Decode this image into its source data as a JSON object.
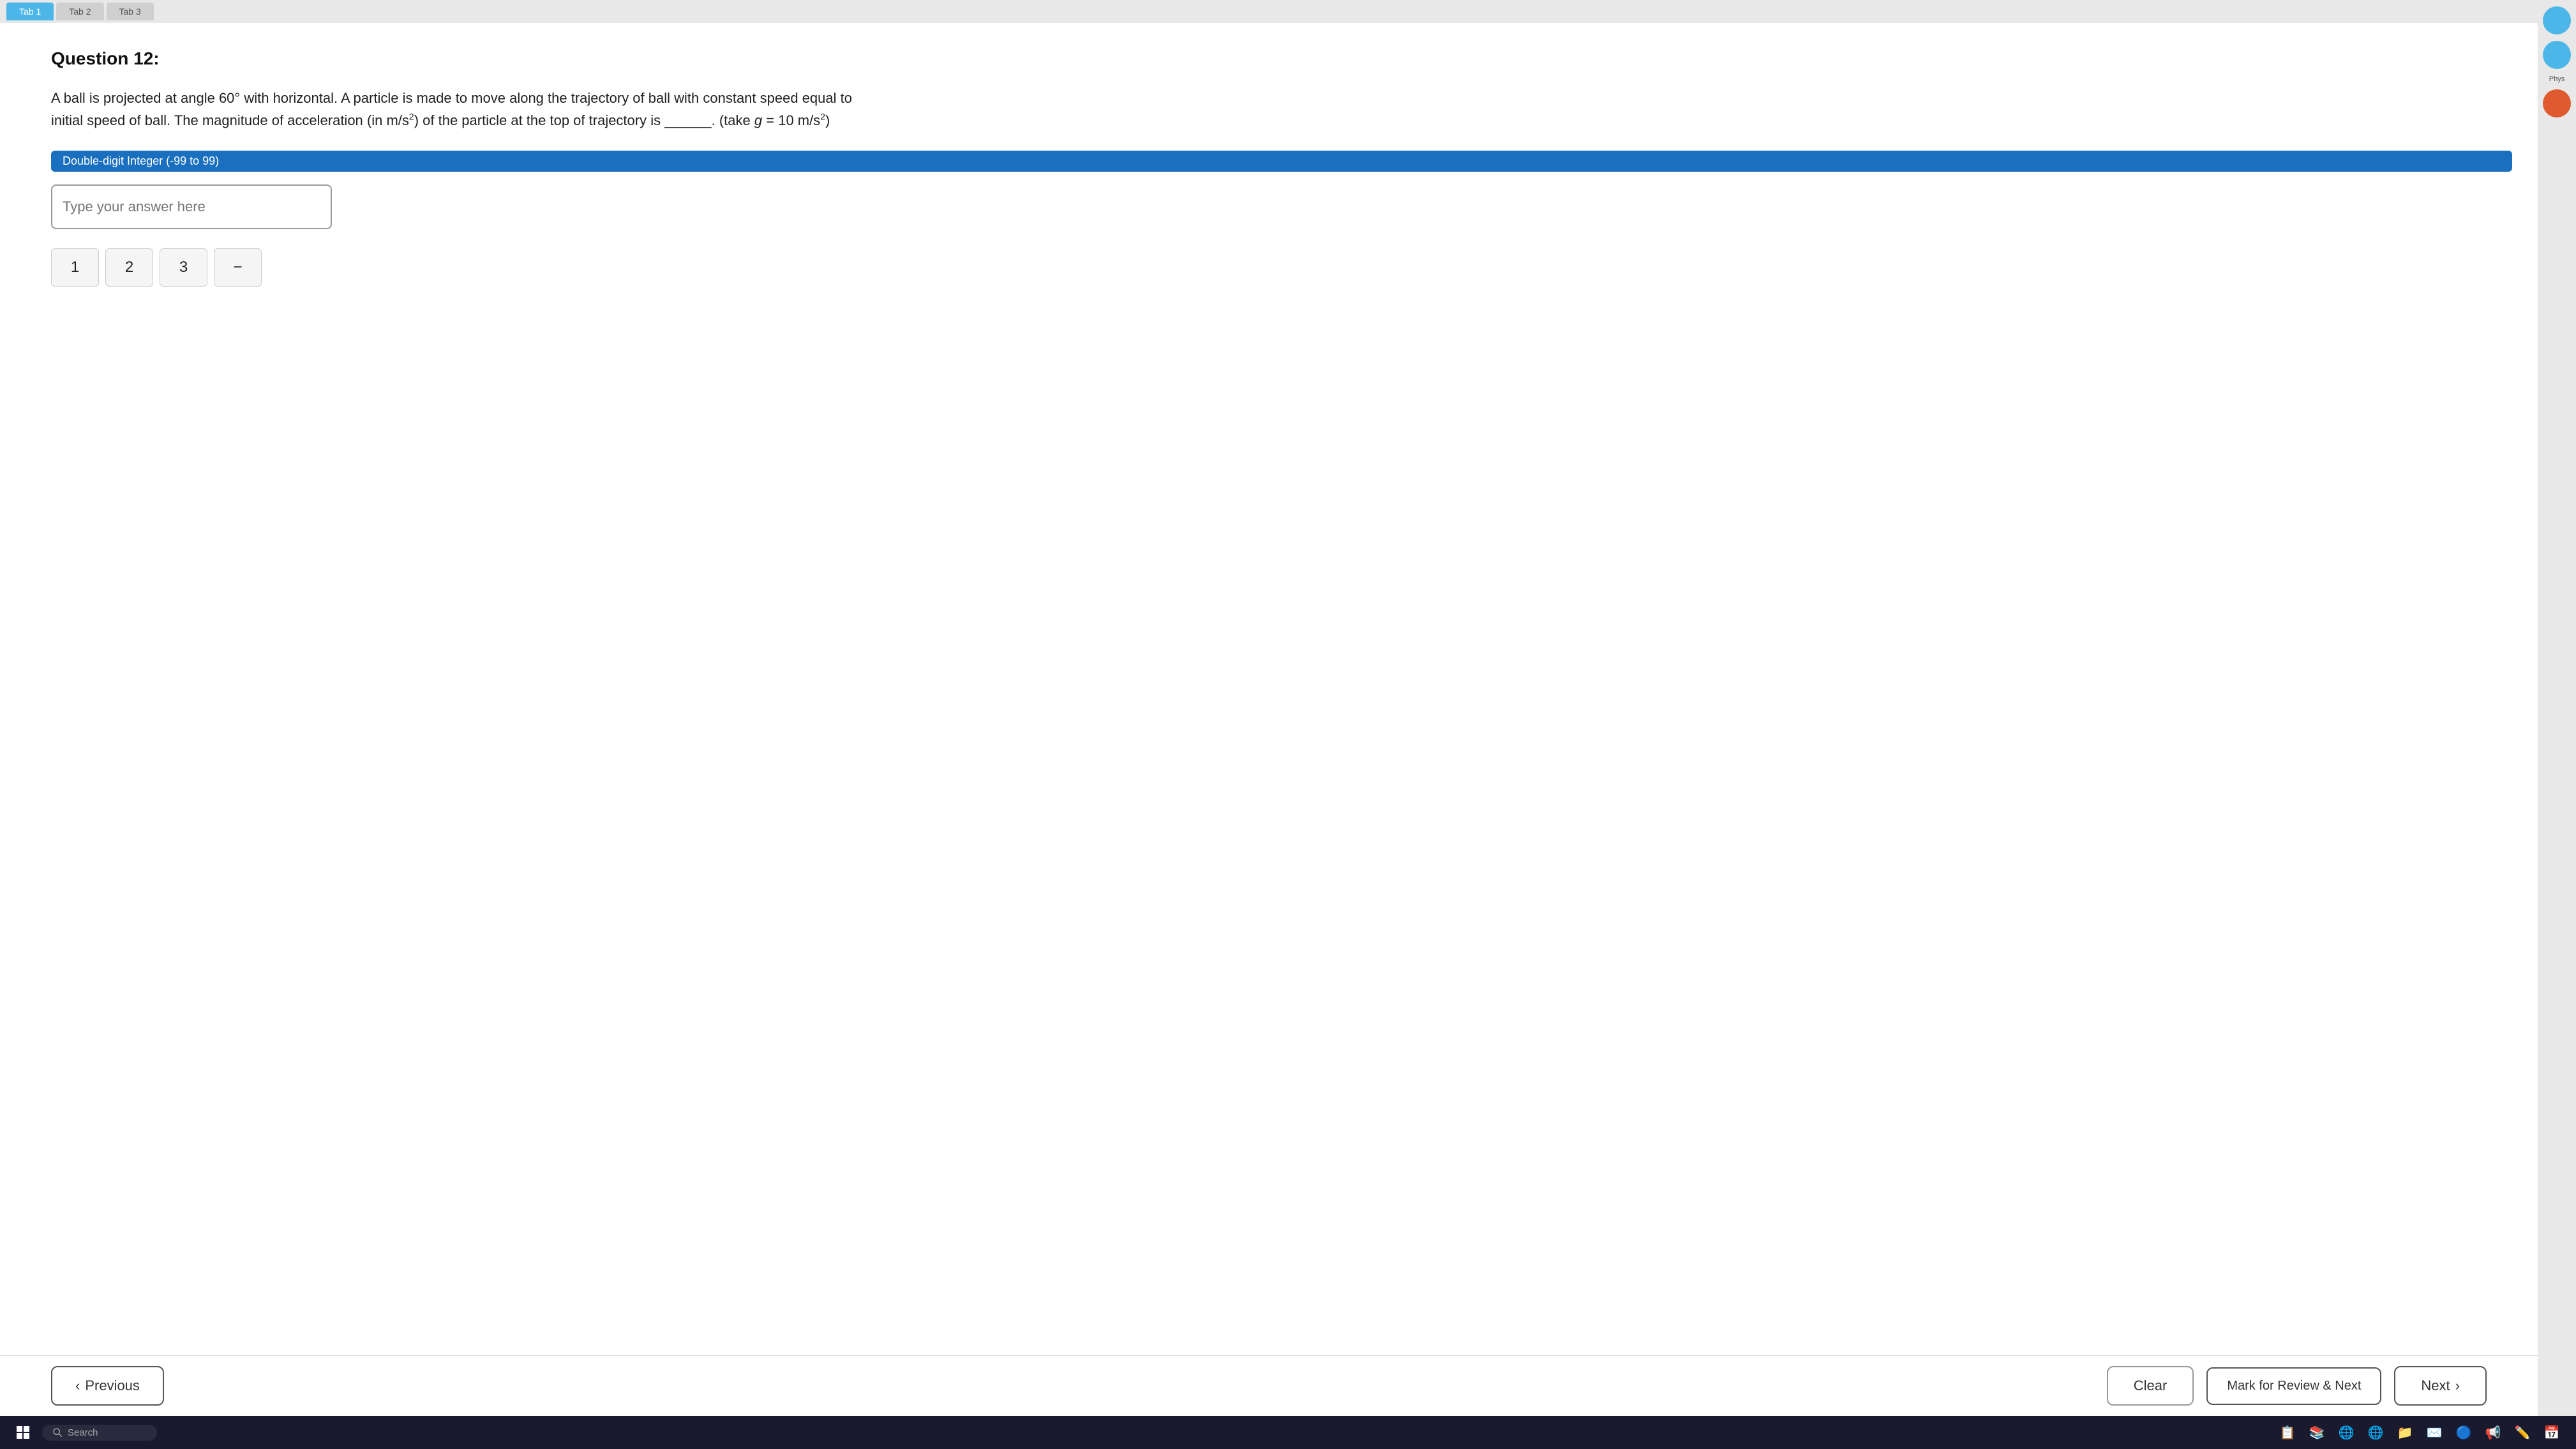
{
  "tabs": {
    "active": "Tab 1",
    "inactive": [
      "Tab 2",
      "Tab 3"
    ]
  },
  "question": {
    "number": "Question 12:",
    "text_part1": "A ball is projected at angle 60° with horizontal. A particle is made to move along the trajectory of ball with constant speed equal to initial speed of ball. The magnitude of acceleration (in m/s",
    "text_sup": "2",
    "text_part2": ") of the particle at the top of trajectory is ______. (take g = 10 m/s",
    "text_sup2": "2",
    "text_part3": ")"
  },
  "badge": {
    "label": "Double-digit Integer (-99 to 99)"
  },
  "input": {
    "placeholder": "Type your answer here"
  },
  "numpad": {
    "keys": [
      "1",
      "2",
      "3",
      "−"
    ]
  },
  "buttons": {
    "previous": "< Previous",
    "previous_label": "Previous",
    "clear": "Clear",
    "mark_review": "Mark for Review & Next",
    "next": "Next >",
    "next_label": "Next"
  },
  "sidebar": {
    "phys_label": "Phys"
  },
  "taskbar": {
    "search_placeholder": "Search",
    "windows_icon": "⊞"
  }
}
